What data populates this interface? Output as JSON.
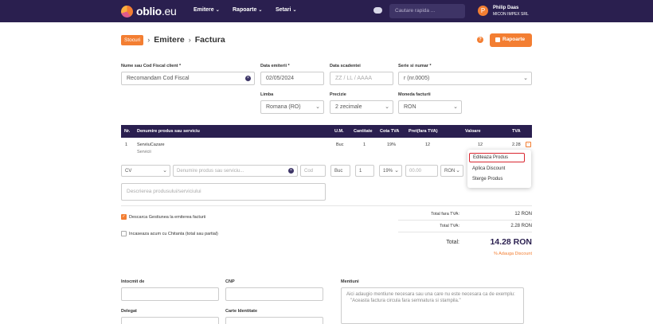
{
  "topbar": {
    "logo_name": "oblio",
    "logo_suffix": ".eu",
    "nav": [
      "Emitere",
      "Rapoarte",
      "Setari"
    ],
    "search_placeholder": "Cautare rapida ...",
    "user_initial": "P",
    "user_name": "Philip Daas",
    "user_company": "MICON IMPEX SRL",
    "icons": [
      "cloud-icon",
      "chevron-down-icon"
    ],
    "accent": "#f37e32",
    "bar_color": "#2a1f4f"
  },
  "breadcrumb": {
    "badge": "Stocuri",
    "items": [
      "Emitere",
      "Factura"
    ],
    "separator": "›"
  },
  "header_actions": {
    "help": "?",
    "reports_label": "Rapoarte"
  },
  "form": {
    "client_label": "Nume sau Cod Fiscal client *",
    "client_value": "Recomandam Cod Fiscal",
    "issue_date_label": "Data emiterii *",
    "issue_date_value": "02/05/2024",
    "due_date_label": "Data scadentei",
    "due_date_placeholder": "ZZ / LL / AAAA",
    "series_label": "Serie si numar *",
    "series_value": "r (nr.0005)",
    "language_label": "Limba",
    "language_value": "Romana (RO)",
    "precision_label": "Precizie",
    "precision_value": "2 zecimale",
    "currency_label": "Moneda facturii",
    "currency_value": "RON"
  },
  "table": {
    "headers": [
      "Nr.",
      "Denumire produs sau serviciu",
      "U.M.",
      "Cantitate",
      "Cota TVA",
      "Pret(fara TVA)",
      "Valoare",
      "TVA"
    ],
    "rows": [
      {
        "nr": "1",
        "name": "ServiiuCazare",
        "sub": "Servicii",
        "um": "Buc",
        "qty": "1",
        "vat": "19%",
        "price": "12",
        "value": "12",
        "tva": "2.28"
      }
    ],
    "row_menu": "−"
  },
  "row_menu": {
    "items": [
      "Editeaza Produs",
      "Aplica Discount",
      "Sterge Produs"
    ]
  },
  "new_line": {
    "type": "CV",
    "name_placeholder": "Denumire produs sau serviciu...",
    "code_placeholder": "Cod",
    "um": "Buc",
    "qty": "1",
    "vat": "19%",
    "price_placeholder": "00.00",
    "currency": "RON",
    "description_placeholder": "Descrierea produsului/serviciului"
  },
  "options": {
    "stock_check": "Descarca Gestiunea la emiterea facturii",
    "stock_checked": true,
    "receipt_check": "Incaseaza acum cu Chitanta (total sau partial)",
    "receipt_checked": false
  },
  "totals": {
    "no_vat_label": "Total fara TVA:",
    "no_vat_value": "12 RON",
    "vat_label": "Total TVA:",
    "vat_value": "2.28 RON",
    "total_label": "Total:",
    "total_value": "14.28 RON",
    "discount_link": "% Adauga Discount"
  },
  "bottom": {
    "issued_by_label": "Intocmit de",
    "cnp_label": "CNP",
    "delegate_label": "Delegat",
    "id_card_label": "Carte Identitate",
    "mentions_label": "Mentiuni",
    "mentions_placeholder_1": "Aici adaugio mentiune necesara sau una care nu este necesara ca de exemplu:",
    "mentions_placeholder_2": "\"Aceasta factura circula fara semnatura si stampila.\""
  }
}
